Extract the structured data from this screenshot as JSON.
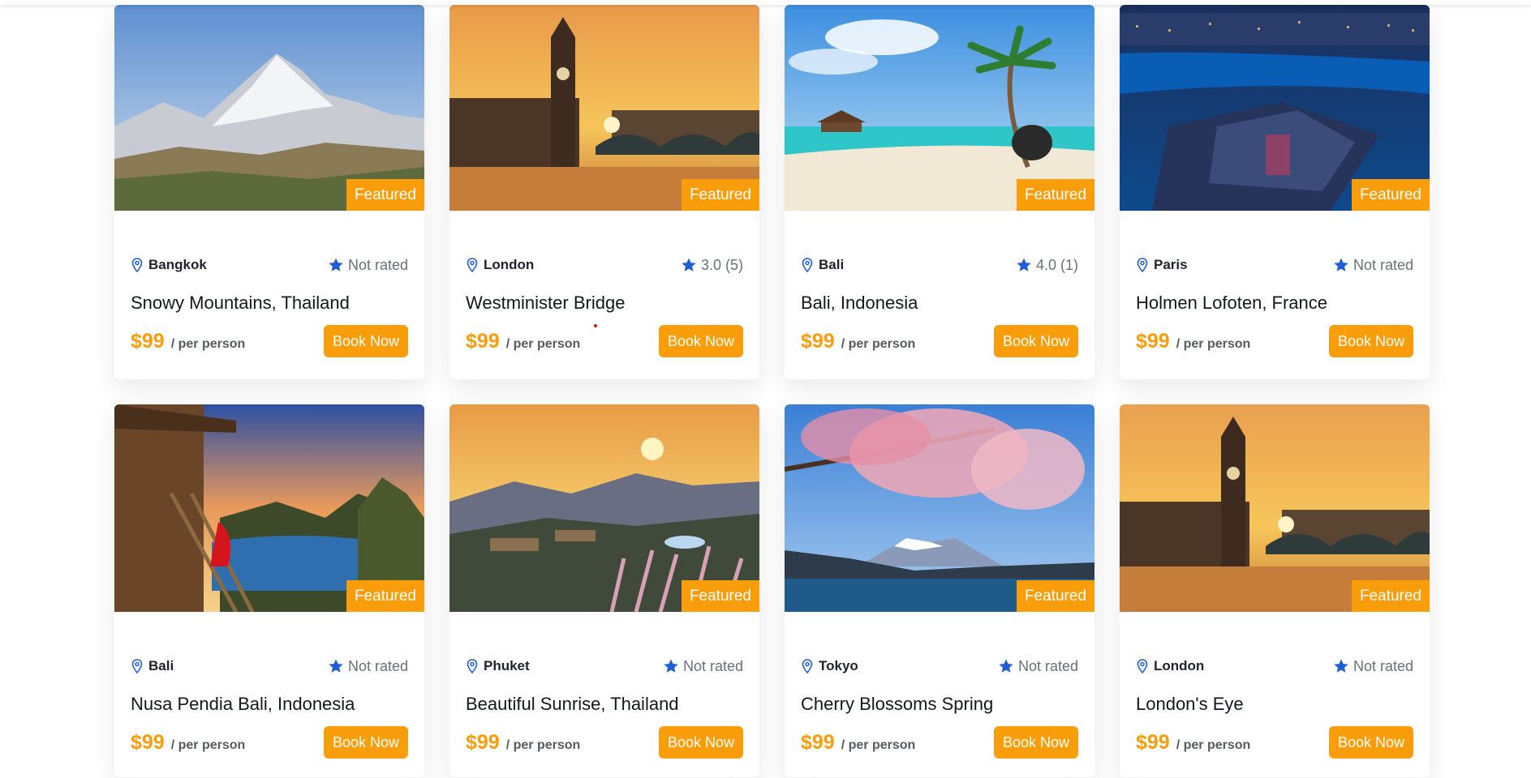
{
  "colors": {
    "accent": "#fa9d0a",
    "icon": "#1f5fd6",
    "star": "#1f5fd6"
  },
  "cards": [
    {
      "location": "Bangkok",
      "rating": "Not rated",
      "title": "Snowy Mountains, Thailand",
      "price": "$99",
      "per": "/ per person",
      "badge": "Featured",
      "book": "Book Now"
    },
    {
      "location": "London",
      "rating": "3.0 (5)",
      "title": "Westminister Bridge",
      "price": "$99",
      "per": "/ per person",
      "badge": "Featured",
      "book": "Book Now"
    },
    {
      "location": "Bali",
      "rating": "4.0 (1)",
      "title": "Bali, Indonesia",
      "price": "$99",
      "per": "/ per person",
      "badge": "Featured",
      "book": "Book Now"
    },
    {
      "location": "Paris",
      "rating": "Not rated",
      "title": "Holmen Lofoten, France",
      "price": "$99",
      "per": "/ per person",
      "badge": "Featured",
      "book": "Book Now"
    },
    {
      "location": "Bali",
      "rating": "Not rated",
      "title": "Nusa Pendia Bali, Indonesia",
      "price": "$99",
      "per": "/ per person",
      "badge": "Featured",
      "book": "Book Now"
    },
    {
      "location": "Phuket",
      "rating": "Not rated",
      "title": "Beautiful Sunrise, Thailand",
      "price": "$99",
      "per": "/ per person",
      "badge": "Featured",
      "book": "Book Now"
    },
    {
      "location": "Tokyo",
      "rating": "Not rated",
      "title": "Cherry Blossoms Spring",
      "price": "$99",
      "per": "/ per person",
      "badge": "Featured",
      "book": "Book Now"
    },
    {
      "location": "London",
      "rating": "Not rated",
      "title": "London's Eye",
      "price": "$99",
      "per": "/ per person",
      "badge": "Featured",
      "book": "Book Now"
    }
  ]
}
